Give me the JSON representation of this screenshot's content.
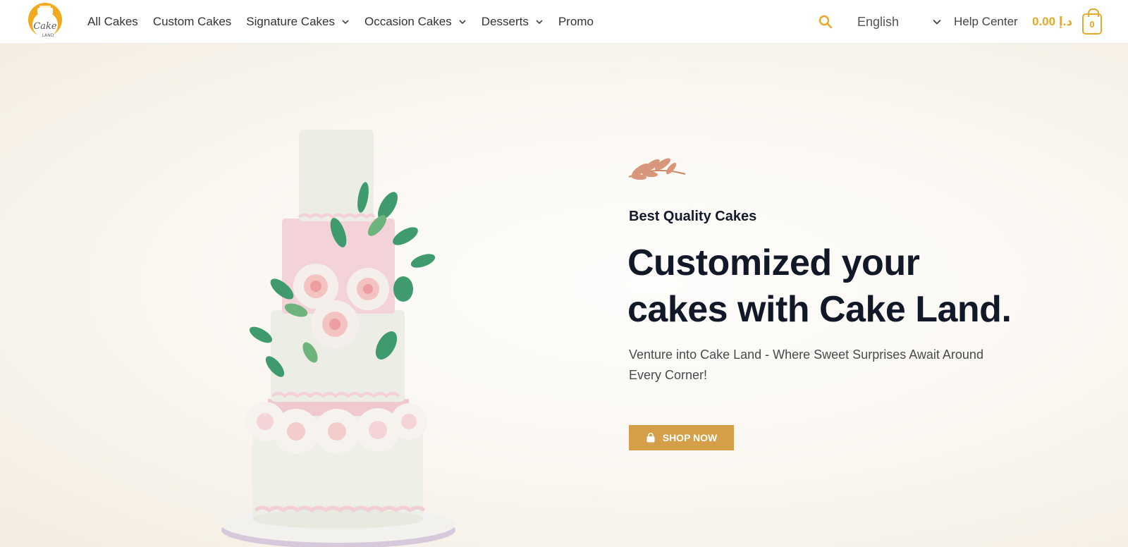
{
  "header": {
    "logo_text": "Cake LAND",
    "nav": [
      {
        "label": "All Cakes",
        "has_dropdown": false
      },
      {
        "label": "Custom Cakes",
        "has_dropdown": false
      },
      {
        "label": "Signature Cakes",
        "has_dropdown": true
      },
      {
        "label": "Occasion Cakes",
        "has_dropdown": true
      },
      {
        "label": "Desserts",
        "has_dropdown": true
      },
      {
        "label": "Promo",
        "has_dropdown": false
      }
    ],
    "search_icon": "search-icon",
    "language": "English",
    "help_center": "Help Center",
    "cart_total": "0.00 د.إ",
    "cart_count": "0",
    "accent_color": "#e6a92a"
  },
  "hero": {
    "kicker": "Best Quality Cakes",
    "headline": "Customized your cakes with Cake Land.",
    "description": "Venture into Cake Land - Where Sweet Surprises Await Around Every Corner!",
    "cta_label": "SHOP NOW",
    "cta_color": "#d59f47"
  }
}
